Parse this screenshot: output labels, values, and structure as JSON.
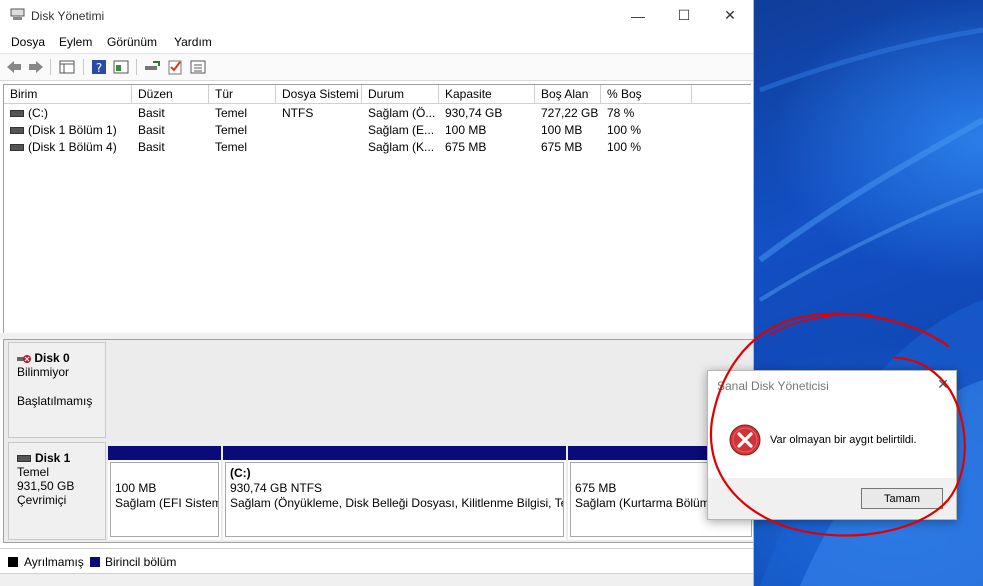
{
  "window": {
    "title": "Disk Yönetimi",
    "minimize_glyph": "—",
    "maximize_glyph": "☐",
    "close_glyph": "✕"
  },
  "menu": [
    "Dosya",
    "Eylem",
    "Görünüm",
    "Yardım"
  ],
  "toolbar_icons": [
    "back-arrow-icon",
    "forward-arrow-icon",
    "show-hide-console-tree-icon",
    "help-icon",
    "properties-icon",
    "connect-icon",
    "checkmark-icon",
    "list-icon"
  ],
  "volume_table": {
    "columns": [
      "Birim",
      "Düzen",
      "Tür",
      "Dosya Sistemi",
      "Durum",
      "Kapasite",
      "Boş Alan",
      "% Boş"
    ],
    "rows": [
      [
        "(C:)",
        "Basit",
        "Temel",
        "NTFS",
        "Sağlam (Ö...",
        "930,74 GB",
        "727,22 GB",
        "78 %"
      ],
      [
        "(Disk 1 Bölüm 1)",
        "Basit",
        "Temel",
        "",
        "Sağlam (E...",
        "100 MB",
        "100 MB",
        "100 %"
      ],
      [
        "(Disk 1 Bölüm 4)",
        "Basit",
        "Temel",
        "",
        "Sağlam (K...",
        "675 MB",
        "675 MB",
        "100 %"
      ]
    ]
  },
  "disks": [
    {
      "name": "Disk 0",
      "line1": "Bilinmiyor",
      "line2": "Başlatılmamış"
    },
    {
      "name": "Disk 1",
      "line1": "Temel",
      "line2": "931,50 GB",
      "line3": "Çevrimiçi"
    }
  ],
  "partitions": [
    {
      "title": "",
      "size": "100 MB",
      "status": "Sağlam (EFI Sistem"
    },
    {
      "title": "(C:)",
      "size": "930,74 GB NTFS",
      "status": "Sağlam (Önyükleme, Disk Belleği Dosyası, Kilitlenme Bilgisi, Ter"
    },
    {
      "title": "",
      "size": "675 MB",
      "status": "Sağlam (Kurtarma Bölüm"
    }
  ],
  "legend": [
    {
      "label": "Ayrılmamış",
      "color": "#000000"
    },
    {
      "label": "Birincil bölüm",
      "color": "#0a0a78"
    }
  ],
  "dialog": {
    "title": "Sanal Disk Yöneticisi",
    "message": "Var olmayan bir aygıt belirtildi.",
    "ok_label": "Tamam",
    "close_glyph": "✕"
  },
  "colors": {
    "partition_bar": "#0a0a78",
    "error_red": "#d13438",
    "annotation_red": "#e00000"
  }
}
